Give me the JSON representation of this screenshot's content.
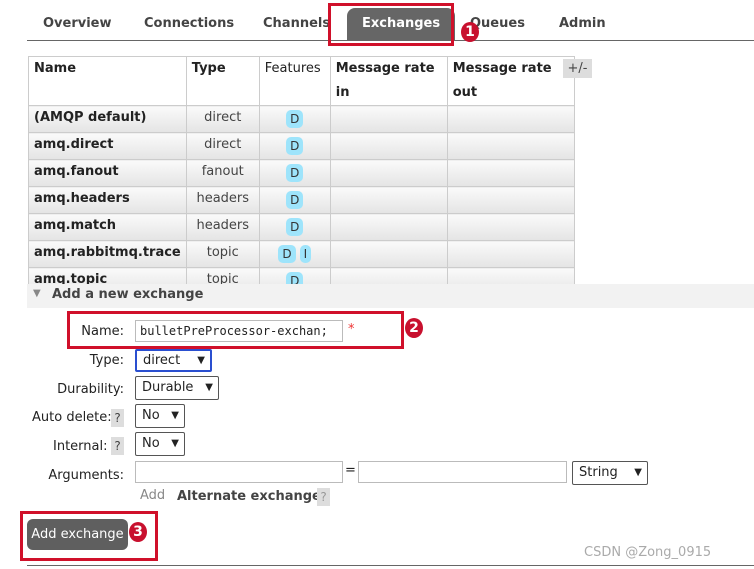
{
  "tabs": [
    "Overview",
    "Connections",
    "Channels",
    "Exchanges",
    "Queues",
    "Admin"
  ],
  "active_tab": "Exchanges",
  "table": {
    "headers": [
      "Name",
      "Type",
      "Features",
      "Message rate in",
      "Message rate out"
    ],
    "toggle_columns": "+/-",
    "rows": [
      {
        "name": "(AMQP default)",
        "type": "direct",
        "features": [
          "D"
        ]
      },
      {
        "name": "amq.direct",
        "type": "direct",
        "features": [
          "D"
        ]
      },
      {
        "name": "amq.fanout",
        "type": "fanout",
        "features": [
          "D"
        ]
      },
      {
        "name": "amq.headers",
        "type": "headers",
        "features": [
          "D"
        ]
      },
      {
        "name": "amq.match",
        "type": "headers",
        "features": [
          "D"
        ]
      },
      {
        "name": "amq.rabbitmq.trace",
        "type": "topic",
        "features": [
          "D",
          "I"
        ]
      },
      {
        "name": "amq.topic",
        "type": "topic",
        "features": [
          "D"
        ]
      }
    ]
  },
  "form": {
    "section_title": "Add a new exchange",
    "name_label": "Name:",
    "name_value": "bulletPreProcessor-exchan;",
    "required": "*",
    "type_label": "Type:",
    "type_value": "direct",
    "durability_label": "Durability:",
    "durability_value": "Durable",
    "auto_delete_label": "Auto delete:",
    "auto_delete_value": "No",
    "internal_label": "Internal:",
    "internal_value": "No",
    "help": "?",
    "arguments_label": "Arguments:",
    "equals": "=",
    "arg_type_value": "String",
    "add_link": "Add",
    "alternate_exchange": "Alternate exchange",
    "submit": "Add exchange"
  },
  "annotations": [
    "1",
    "2",
    "3"
  ],
  "watermark": "CSDN @Zong_0915",
  "colors": {
    "annotation": "#c8102e",
    "active_tab": "#666666",
    "feature_badge": "#9ee4fb"
  }
}
